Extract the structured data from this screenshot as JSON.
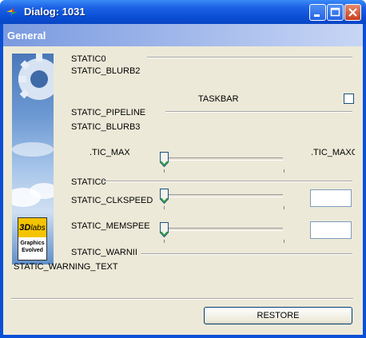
{
  "window": {
    "title": "Dialog: 1031",
    "buttons": {
      "minimize": "minimize",
      "maximize": "maximize",
      "close": "close"
    }
  },
  "group": {
    "header": "General"
  },
  "banner": {
    "logo_brand": "3Dlabs",
    "logo_tagline_1": "Graphics",
    "logo_tagline_2": "Evolved"
  },
  "labels": {
    "static0_top": "STATIC0",
    "blurb2": "STATIC_BLURB2",
    "taskbar": "TASKBAR",
    "pipeline": "STATIC_PIPELINE",
    "blurb3": "STATIC_BLURB3",
    "tic_max_left": ".TIC_MAX",
    "tic_max_right": ".TIC_MAXC",
    "static0_mid": "STATIC0",
    "clkspeed": "STATIC_CLKSPEED",
    "memspeed": "STATIC_MEMSPEE",
    "warning": "STATIC_WARNII",
    "warning_text": "STATIC_WARNING_TEXT"
  },
  "taskbar_checkbox": {
    "checked": false
  },
  "sliders": {
    "max": {
      "value_fraction": 0.0
    },
    "clk": {
      "value_fraction": 0.0
    },
    "mem": {
      "value_fraction": 0.0
    }
  },
  "edits": {
    "clk_value": "",
    "mem_value": ""
  },
  "buttons": {
    "restore": "RESTORE"
  },
  "colors": {
    "title_bar": "#0a4fd6",
    "client_bg": "#ece9d8",
    "group_header": "#7a9ae0"
  }
}
